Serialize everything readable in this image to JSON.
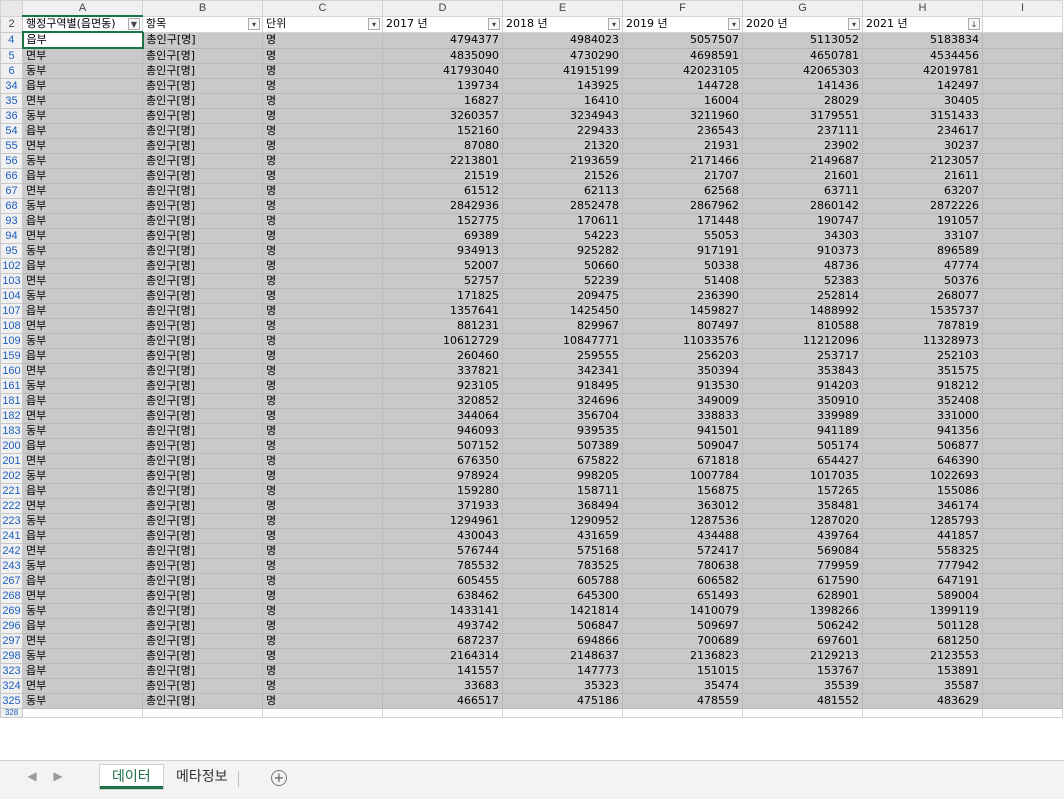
{
  "columns": [
    "A",
    "B",
    "C",
    "D",
    "E",
    "F",
    "G",
    "H",
    "I"
  ],
  "filter_row": {
    "row_number": "2",
    "headers": [
      "행정구역별(읍면동)",
      "항목",
      "단위",
      "2017 년",
      "2018 년",
      "2019 년",
      "2020 년",
      "2021 년"
    ]
  },
  "filter_icons": {
    "A": "▼",
    "B": "▾",
    "C": "▾",
    "D": "▾",
    "E": "▾",
    "F": "▾",
    "G": "▾",
    "H": "↓"
  },
  "rows": [
    {
      "n": "4",
      "r": [
        "읍부",
        "총인구[명]",
        "명",
        "4794377",
        "4984023",
        "5057507",
        "5113052",
        "5183834"
      ]
    },
    {
      "n": "5",
      "r": [
        "면부",
        "총인구[명]",
        "명",
        "4835090",
        "4730290",
        "4698591",
        "4650781",
        "4534456"
      ]
    },
    {
      "n": "6",
      "r": [
        "동부",
        "총인구[명]",
        "명",
        "41793040",
        "41915199",
        "42023105",
        "42065303",
        "42019781"
      ]
    },
    {
      "n": "34",
      "r": [
        "읍부",
        "총인구[명]",
        "명",
        "139734",
        "143925",
        "144728",
        "141436",
        "142497"
      ]
    },
    {
      "n": "35",
      "r": [
        "면부",
        "총인구[명]",
        "명",
        "16827",
        "16410",
        "16004",
        "28029",
        "30405"
      ]
    },
    {
      "n": "36",
      "r": [
        "동부",
        "총인구[명]",
        "명",
        "3260357",
        "3234943",
        "3211960",
        "3179551",
        "3151433"
      ]
    },
    {
      "n": "54",
      "r": [
        "읍부",
        "총인구[명]",
        "명",
        "152160",
        "229433",
        "236543",
        "237111",
        "234617"
      ]
    },
    {
      "n": "55",
      "r": [
        "면부",
        "총인구[명]",
        "명",
        "87080",
        "21320",
        "21931",
        "23902",
        "30237"
      ]
    },
    {
      "n": "56",
      "r": [
        "동부",
        "총인구[명]",
        "명",
        "2213801",
        "2193659",
        "2171466",
        "2149687",
        "2123057"
      ]
    },
    {
      "n": "66",
      "r": [
        "읍부",
        "총인구[명]",
        "명",
        "21519",
        "21526",
        "21707",
        "21601",
        "21611"
      ]
    },
    {
      "n": "67",
      "r": [
        "면부",
        "총인구[명]",
        "명",
        "61512",
        "62113",
        "62568",
        "63711",
        "63207"
      ]
    },
    {
      "n": "68",
      "r": [
        "동부",
        "총인구[명]",
        "명",
        "2842936",
        "2852478",
        "2867962",
        "2860142",
        "2872226"
      ]
    },
    {
      "n": "93",
      "r": [
        "읍부",
        "총인구[명]",
        "명",
        "152775",
        "170611",
        "171448",
        "190747",
        "191057"
      ]
    },
    {
      "n": "94",
      "r": [
        "면부",
        "총인구[명]",
        "명",
        "69389",
        "54223",
        "55053",
        "34303",
        "33107"
      ]
    },
    {
      "n": "95",
      "r": [
        "동부",
        "총인구[명]",
        "명",
        "934913",
        "925282",
        "917191",
        "910373",
        "896589"
      ]
    },
    {
      "n": "102",
      "r": [
        "읍부",
        "총인구[명]",
        "명",
        "52007",
        "50660",
        "50338",
        "48736",
        "47774"
      ]
    },
    {
      "n": "103",
      "r": [
        "면부",
        "총인구[명]",
        "명",
        "52757",
        "52239",
        "51408",
        "52383",
        "50376"
      ]
    },
    {
      "n": "104",
      "r": [
        "동부",
        "총인구[명]",
        "명",
        "171825",
        "209475",
        "236390",
        "252814",
        "268077"
      ]
    },
    {
      "n": "107",
      "r": [
        "읍부",
        "총인구[명]",
        "명",
        "1357641",
        "1425450",
        "1459827",
        "1488992",
        "1535737"
      ]
    },
    {
      "n": "108",
      "r": [
        "면부",
        "총인구[명]",
        "명",
        "881231",
        "829967",
        "807497",
        "810588",
        "787819"
      ]
    },
    {
      "n": "109",
      "r": [
        "동부",
        "총인구[명]",
        "명",
        "10612729",
        "10847771",
        "11033576",
        "11212096",
        "11328973"
      ]
    },
    {
      "n": "159",
      "r": [
        "읍부",
        "총인구[명]",
        "명",
        "260460",
        "259555",
        "256203",
        "253717",
        "252103"
      ]
    },
    {
      "n": "160",
      "r": [
        "면부",
        "총인구[명]",
        "명",
        "337821",
        "342341",
        "350394",
        "353843",
        "351575"
      ]
    },
    {
      "n": "161",
      "r": [
        "동부",
        "총인구[명]",
        "명",
        "923105",
        "918495",
        "913530",
        "914203",
        "918212"
      ]
    },
    {
      "n": "181",
      "r": [
        "읍부",
        "총인구[명]",
        "명",
        "320852",
        "324696",
        "349009",
        "350910",
        "352408"
      ]
    },
    {
      "n": "182",
      "r": [
        "면부",
        "총인구[명]",
        "명",
        "344064",
        "356704",
        "338833",
        "339989",
        "331000"
      ]
    },
    {
      "n": "183",
      "r": [
        "동부",
        "총인구[명]",
        "명",
        "946093",
        "939535",
        "941501",
        "941189",
        "941356"
      ]
    },
    {
      "n": "200",
      "r": [
        "읍부",
        "총인구[명]",
        "명",
        "507152",
        "507389",
        "509047",
        "505174",
        "506877"
      ]
    },
    {
      "n": "201",
      "r": [
        "면부",
        "총인구[명]",
        "명",
        "676350",
        "675822",
        "671818",
        "654427",
        "646390"
      ]
    },
    {
      "n": "202",
      "r": [
        "동부",
        "총인구[명]",
        "명",
        "978924",
        "998205",
        "1007784",
        "1017035",
        "1022693"
      ]
    },
    {
      "n": "221",
      "r": [
        "읍부",
        "총인구[명]",
        "명",
        "159280",
        "158711",
        "156875",
        "157265",
        "155086"
      ]
    },
    {
      "n": "222",
      "r": [
        "면부",
        "총인구[명]",
        "명",
        "371933",
        "368494",
        "363012",
        "358481",
        "346174"
      ]
    },
    {
      "n": "223",
      "r": [
        "동부",
        "총인구[명]",
        "명",
        "1294961",
        "1290952",
        "1287536",
        "1287020",
        "1285793"
      ]
    },
    {
      "n": "241",
      "r": [
        "읍부",
        "총인구[명]",
        "명",
        "430043",
        "431659",
        "434488",
        "439764",
        "441857"
      ]
    },
    {
      "n": "242",
      "r": [
        "면부",
        "총인구[명]",
        "명",
        "576744",
        "575168",
        "572417",
        "569084",
        "558325"
      ]
    },
    {
      "n": "243",
      "r": [
        "동부",
        "총인구[명]",
        "명",
        "785532",
        "783525",
        "780638",
        "779959",
        "777942"
      ]
    },
    {
      "n": "267",
      "r": [
        "읍부",
        "총인구[명]",
        "명",
        "605455",
        "605788",
        "606582",
        "617590",
        "647191"
      ]
    },
    {
      "n": "268",
      "r": [
        "면부",
        "총인구[명]",
        "명",
        "638462",
        "645300",
        "651493",
        "628901",
        "589004"
      ]
    },
    {
      "n": "269",
      "r": [
        "동부",
        "총인구[명]",
        "명",
        "1433141",
        "1421814",
        "1410079",
        "1398266",
        "1399119"
      ]
    },
    {
      "n": "296",
      "r": [
        "읍부",
        "총인구[명]",
        "명",
        "493742",
        "506847",
        "509697",
        "506242",
        "501128"
      ]
    },
    {
      "n": "297",
      "r": [
        "면부",
        "총인구[명]",
        "명",
        "687237",
        "694866",
        "700689",
        "697601",
        "681250"
      ]
    },
    {
      "n": "298",
      "r": [
        "동부",
        "총인구[명]",
        "명",
        "2164314",
        "2148637",
        "2136823",
        "2129213",
        "2123553"
      ]
    },
    {
      "n": "323",
      "r": [
        "읍부",
        "총인구[명]",
        "명",
        "141557",
        "147773",
        "151015",
        "153767",
        "153891"
      ]
    },
    {
      "n": "324",
      "r": [
        "면부",
        "총인구[명]",
        "명",
        "33683",
        "35323",
        "35474",
        "35539",
        "35587"
      ]
    },
    {
      "n": "325",
      "r": [
        "동부",
        "총인구[명]",
        "명",
        "466517",
        "475186",
        "478559",
        "481552",
        "483629"
      ]
    }
  ],
  "partial_row": "328",
  "sheet_tabs": {
    "active": "데이터",
    "other": "메타정보",
    "add": "+",
    "prev": "◀",
    "next": "▶"
  }
}
